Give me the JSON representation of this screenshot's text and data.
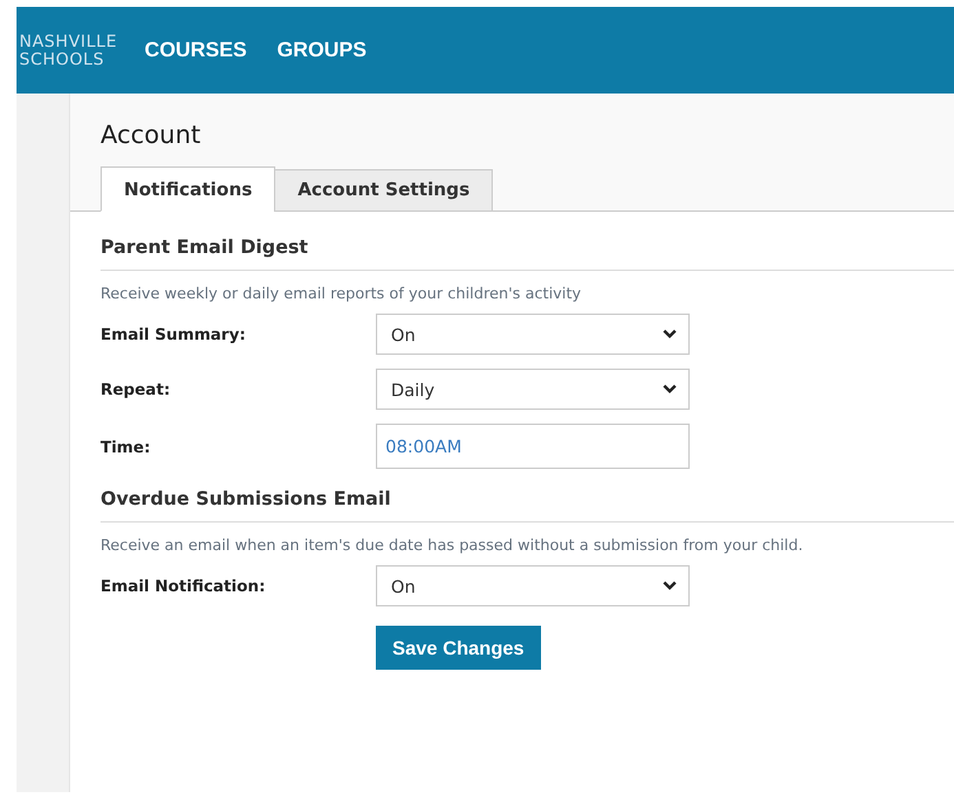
{
  "header": {
    "logo_lines": [
      "NASHVILLE",
      "SCHOOLS"
    ],
    "nav": [
      {
        "label": "COURSES"
      },
      {
        "label": "GROUPS"
      }
    ]
  },
  "page": {
    "title": "Account"
  },
  "tabs": [
    {
      "label": "Notifications",
      "selected": true
    },
    {
      "label": "Account Settings",
      "selected": false
    }
  ],
  "sections": [
    {
      "title": "Parent Email Digest",
      "description": "Receive weekly or daily email reports of your children's activity",
      "fields": [
        {
          "label": "Email Summary:",
          "kind": "select",
          "value": "On"
        },
        {
          "label": "Repeat:",
          "kind": "select",
          "value": "Daily"
        },
        {
          "label": "Time:",
          "kind": "text",
          "value": "08:00AM"
        }
      ]
    },
    {
      "title": "Overdue Submissions Email",
      "description": "Receive an email when an item's due date has passed without a submission from your child.",
      "fields": [
        {
          "label": "Email Notification:",
          "kind": "select",
          "value": "On"
        }
      ]
    }
  ],
  "save_button": "Save Changes"
}
